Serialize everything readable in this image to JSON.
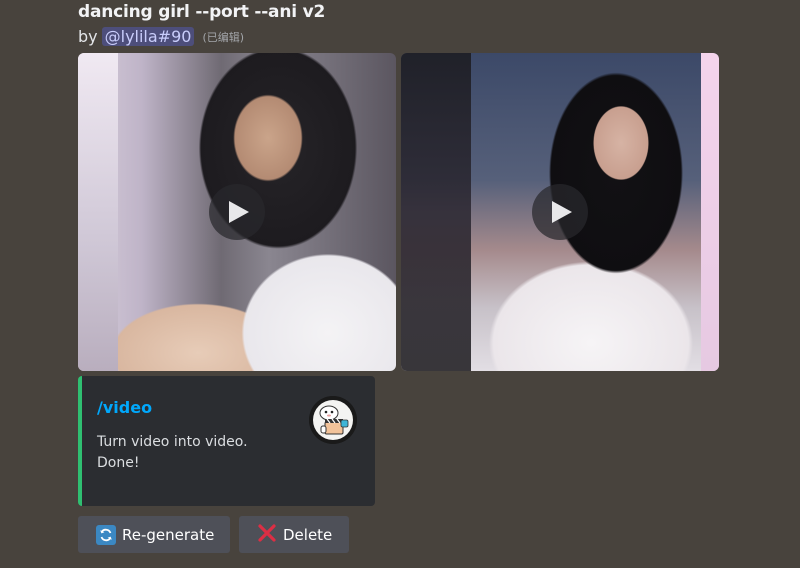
{
  "message": {
    "title": "dancing girl --port --ani v2",
    "by_prefix": "by",
    "mention": "@lylila#90",
    "edited": "(已编辑)"
  },
  "attachments": [
    {
      "icon": "play-icon"
    },
    {
      "icon": "play-icon"
    }
  ],
  "embed": {
    "accent_color": "#2fbf71",
    "title": "/video",
    "description": "Turn video into video.\nDone!"
  },
  "buttons": {
    "regenerate": {
      "icon": "arrows-counterclockwise-icon",
      "label": "Re-generate"
    },
    "delete": {
      "icon": "cross-mark-icon",
      "label": "Delete"
    }
  },
  "colors": {
    "background": "#48433d",
    "link": "#00a8fc",
    "button": "#4e5058"
  }
}
